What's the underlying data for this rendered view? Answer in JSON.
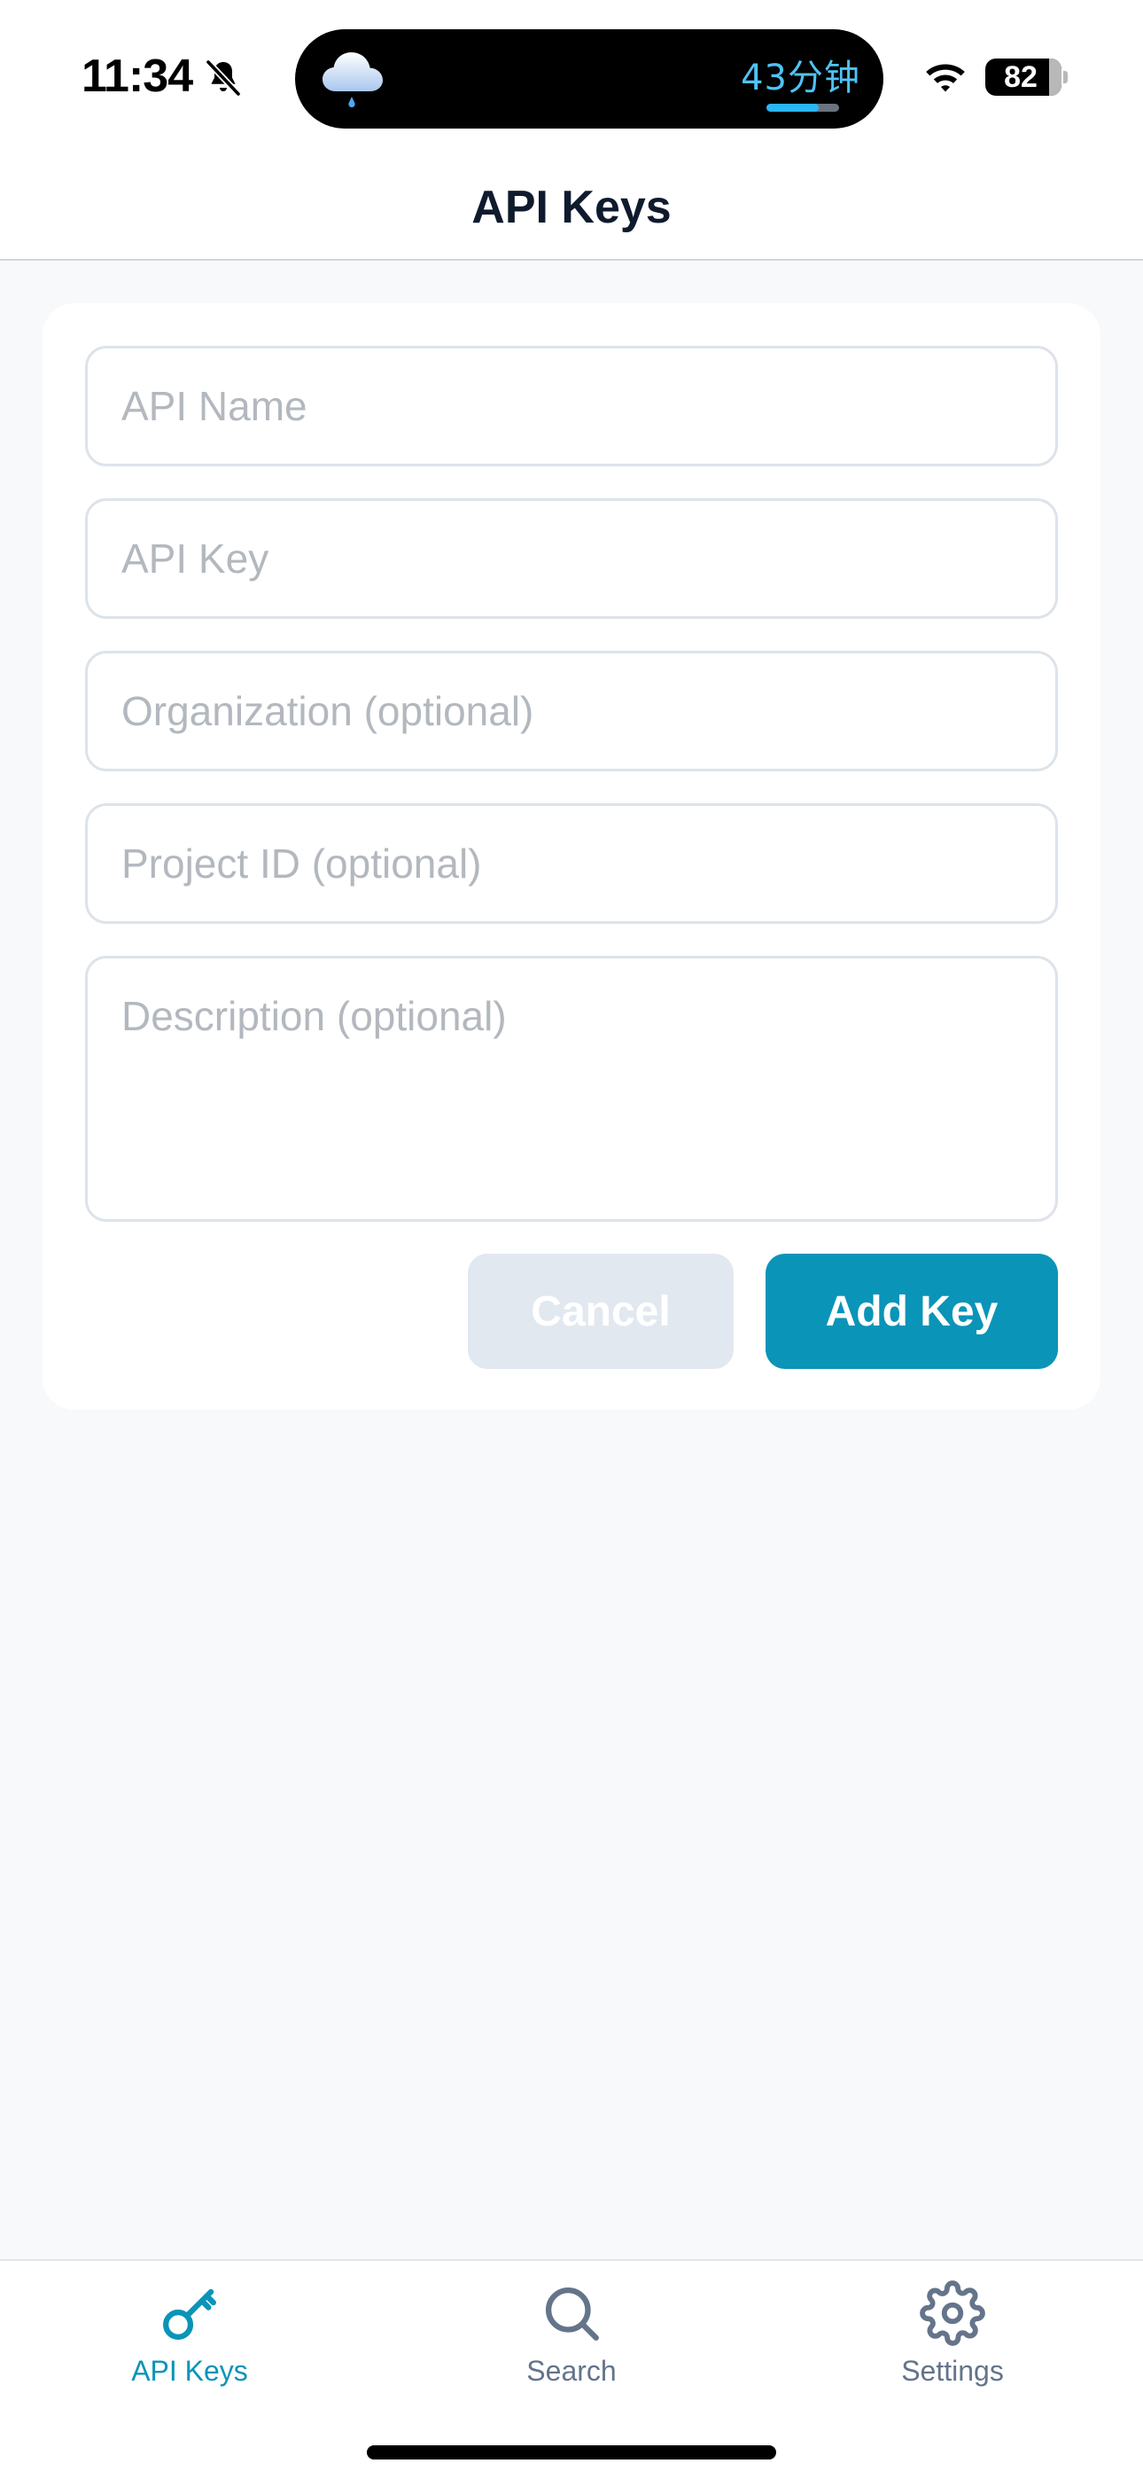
{
  "status_bar": {
    "time": "11:34",
    "island_text": "43分钟",
    "island_progress": 0.72,
    "battery": "82"
  },
  "header": {
    "title": "API Keys"
  },
  "form": {
    "api_name_placeholder": "API Name",
    "api_key_placeholder": "API Key",
    "organization_placeholder": "Organization (optional)",
    "project_id_placeholder": "Project ID (optional)",
    "description_placeholder": "Description (optional)",
    "cancel_label": "Cancel",
    "add_label": "Add Key"
  },
  "tabs": [
    {
      "label": "API Keys",
      "icon": "key-icon",
      "active": true
    },
    {
      "label": "Search",
      "icon": "search-icon",
      "active": false
    },
    {
      "label": "Settings",
      "icon": "gear-icon",
      "active": false
    }
  ],
  "colors": {
    "accent": "#0a94b8",
    "background": "#f8f9fb",
    "cancel_bg": "#e2e8f0",
    "inactive_tab": "#64748b"
  }
}
